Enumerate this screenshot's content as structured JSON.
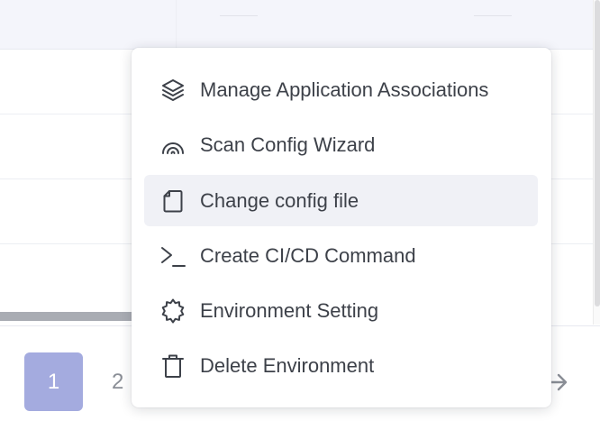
{
  "pagination": {
    "current_page": "1",
    "next_page": "2"
  },
  "context_menu": {
    "items": [
      {
        "label": "Manage Application Associations",
        "icon": "layers-icon"
      },
      {
        "label": "Scan Config Wizard",
        "icon": "rainbow-icon"
      },
      {
        "label": "Change config file",
        "icon": "file-icon"
      },
      {
        "label": "Create CI/CD Command",
        "icon": "terminal-icon"
      },
      {
        "label": "Environment Setting",
        "icon": "gear-icon"
      },
      {
        "label": "Delete Environment",
        "icon": "trash-icon"
      }
    ],
    "highlighted_item": "Change config file"
  },
  "colors": {
    "active_page": "#a4abdf",
    "menu_highlight": "#f0f1f6",
    "table_header": "#f4f5fb",
    "text": "#3d4149"
  }
}
